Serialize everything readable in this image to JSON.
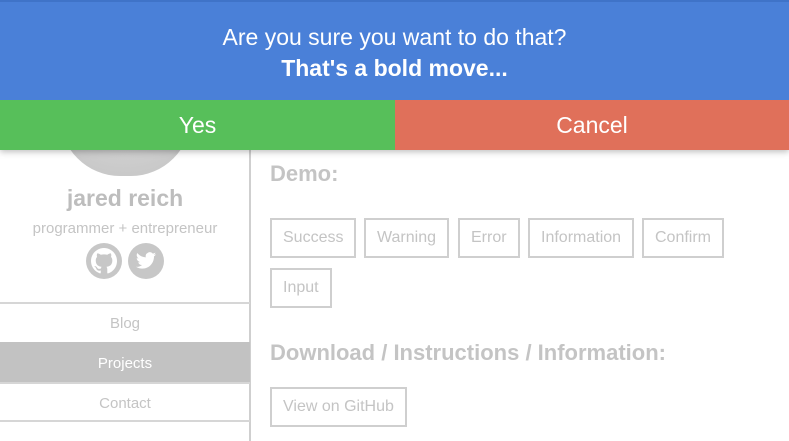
{
  "notification": {
    "message": "Are you sure you want to do that?",
    "submessage": "That's a bold move...",
    "yes_label": "Yes",
    "cancel_label": "Cancel",
    "colors": {
      "info": "#4a80d8",
      "yes": "#57bf5a",
      "cancel": "#e0705a"
    }
  },
  "profile": {
    "name": "jared reich",
    "tagline": "programmer + entrepreneur",
    "social": [
      {
        "icon": "github-icon"
      },
      {
        "icon": "twitter-icon"
      }
    ]
  },
  "nav": {
    "items": [
      {
        "label": "Blog",
        "active": false
      },
      {
        "label": "Projects",
        "active": true
      },
      {
        "label": "Contact",
        "active": false
      }
    ]
  },
  "main": {
    "demo_title": "Demo:",
    "demo_buttons": [
      "Success",
      "Warning",
      "Error",
      "Information",
      "Confirm",
      "Input"
    ],
    "download_title": "Download / Instructions / Information:",
    "github_button": "View on GitHub"
  }
}
